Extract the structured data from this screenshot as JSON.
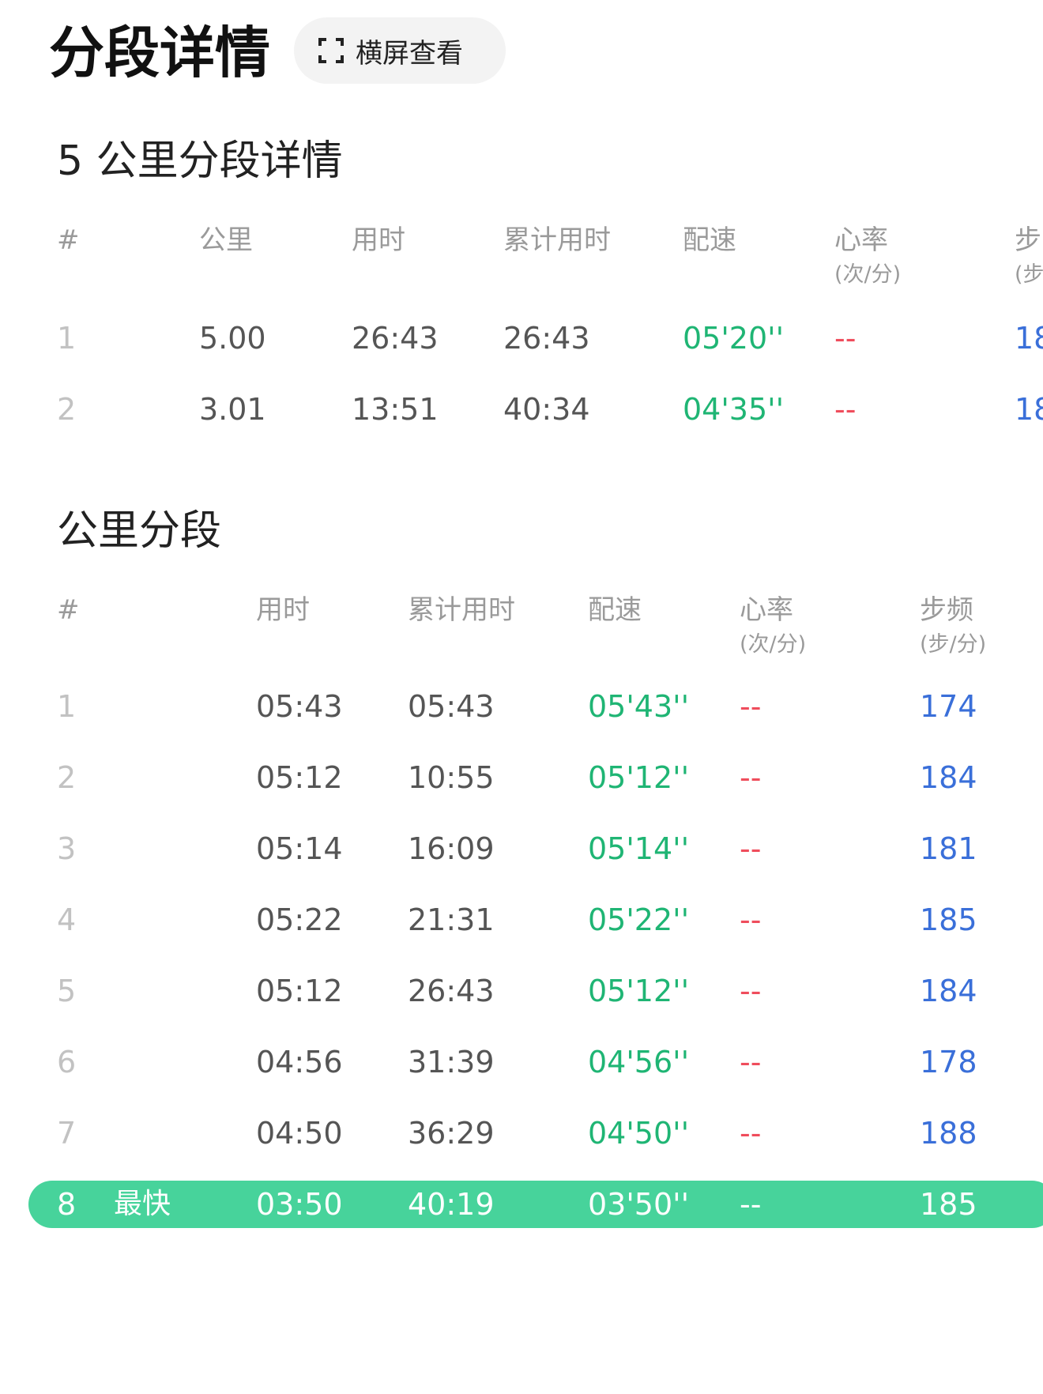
{
  "header": {
    "title": "分段详情",
    "landscape_button_label": "横屏查看",
    "landscape_icon": "fullscreen-icon"
  },
  "five_km_section": {
    "title": "5 公里分段详情",
    "columns": {
      "index": "#",
      "distance": "公里",
      "time": "用时",
      "cumulative": "累计用时",
      "pace": "配速",
      "heart_rate": "心率",
      "heart_rate_unit": "(次/分)",
      "cadence": "步",
      "cadence_unit": "(步"
    },
    "rows": [
      {
        "index": "1",
        "distance": "5.00",
        "time": "26:43",
        "cumulative": "26:43",
        "pace": "05'20''",
        "heart_rate": "--",
        "cadence": "18"
      },
      {
        "index": "2",
        "distance": "3.01",
        "time": "13:51",
        "cumulative": "40:34",
        "pace": "04'35''",
        "heart_rate": "--",
        "cadence": "18"
      }
    ]
  },
  "km_section": {
    "title": "公里分段",
    "columns": {
      "index": "#",
      "time": "用时",
      "cumulative": "累计用时",
      "pace": "配速",
      "heart_rate": "心率",
      "heart_rate_unit": "(次/分)",
      "cadence": "步频",
      "cadence_unit": "(步/分)"
    },
    "rows": [
      {
        "index": "1",
        "time": "05:43",
        "cumulative": "05:43",
        "pace": "05'43''",
        "heart_rate": "--",
        "cadence": "174"
      },
      {
        "index": "2",
        "time": "05:12",
        "cumulative": "10:55",
        "pace": "05'12''",
        "heart_rate": "--",
        "cadence": "184"
      },
      {
        "index": "3",
        "time": "05:14",
        "cumulative": "16:09",
        "pace": "05'14''",
        "heart_rate": "--",
        "cadence": "181"
      },
      {
        "index": "4",
        "time": "05:22",
        "cumulative": "21:31",
        "pace": "05'22''",
        "heart_rate": "--",
        "cadence": "185"
      },
      {
        "index": "5",
        "time": "05:12",
        "cumulative": "26:43",
        "pace": "05'12''",
        "heart_rate": "--",
        "cadence": "184"
      },
      {
        "index": "6",
        "time": "04:56",
        "cumulative": "31:39",
        "pace": "04'56''",
        "heart_rate": "--",
        "cadence": "178"
      },
      {
        "index": "7",
        "time": "04:50",
        "cumulative": "36:29",
        "pace": "04'50''",
        "heart_rate": "--",
        "cadence": "188"
      }
    ],
    "fastest_row": {
      "index": "8",
      "badge": "最快",
      "time": "03:50",
      "cumulative": "40:19",
      "pace": "03'50''",
      "heart_rate": "--",
      "cadence": "185"
    }
  },
  "colors": {
    "pace": "#1fb574",
    "heart_rate": "#ef4d5c",
    "cadence": "#3a6fd9",
    "highlight": "#47d39b"
  }
}
